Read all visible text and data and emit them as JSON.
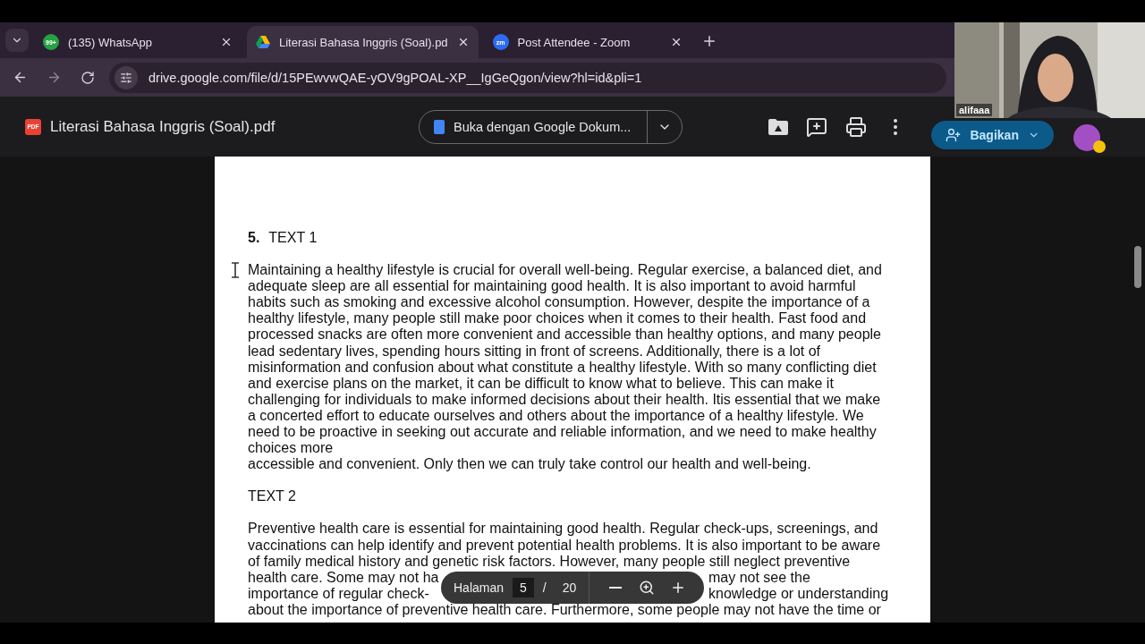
{
  "tabs": [
    {
      "kind": "whatsapp",
      "icon_text": "99+",
      "label": "(135) WhatsApp",
      "selected": false
    },
    {
      "kind": "drive",
      "label": "Literasi Bahasa Inggris (Soal).pd",
      "selected": true
    },
    {
      "kind": "zoom",
      "icon_text": "zm",
      "label": "Post Attendee - Zoom",
      "selected": false
    }
  ],
  "address": "drive.google.com/file/d/15PEwvwQAE-yOV9gPOAL-XP__IgGeQgon/view?hl=id&pli=1",
  "viewer": {
    "file_icon_text": "PDF",
    "file_name": "Literasi Bahasa Inggris (Soal).pdf",
    "open_with": "Buka dengan Google Dokum...",
    "share": "Bagikan"
  },
  "video": {
    "participant": "alifaaa"
  },
  "document": {
    "question_number": "5.",
    "sections": [
      {
        "heading": "TEXT 1",
        "lines": [
          "Maintaining a healthy lifestyle is crucial for overall well-being. Regular exercise, a balanced diet, and",
          "adequate sleep are all essential for maintaining good health. It is also important to avoid harmful",
          "habits such as smoking and excessive alcohol consumption. However, despite the importance of a",
          "healthy lifestyle, many people still make poor choices when it comes to their health. Fast food and",
          "processed snacks are often more convenient and accessible than healthy options, and many people",
          "lead sedentary lives, spending hours sitting in front of screens. Additionally, there is a lot of",
          "misinformation and confusion about what constitute a healthy lifestyle. With so many conflicting diet",
          "and exercise plans on the market, it can be difficult to know what to believe. This can make it",
          "challenging for individuals to make informed decisions about their health. Itis essential that we make",
          "a concerted effort to educate ourselves and others about the importance of a healthy lifestyle. We",
          "need to be proactive in seeking out accurate and reliable information, and we need to make healthy",
          "choices more",
          "accessible and convenient. Only then we can truly take control our health and well-being."
        ]
      },
      {
        "heading": "TEXT 2",
        "lines": [
          "Preventive health care is essential for maintaining good health. Regular check-ups, screenings, and",
          "vaccinations can help identify and prevent potential health problems. It is also important to be aware",
          "of family medical history and genetic risk factors. However, many people still neglect preventive",
          {
            "kind": "split",
            "left": "health care. Some may not ha",
            "right": "may not see the"
          },
          {
            "kind": "split",
            "left": "importance of regular check-",
            "right": "knowledge or understanding"
          },
          "about the importance of preventive health care. Furthermore, some people may not have the time or"
        ]
      }
    ]
  },
  "page_nav": {
    "label": "Halaman",
    "current": "5",
    "separator": "/",
    "total": "20"
  }
}
